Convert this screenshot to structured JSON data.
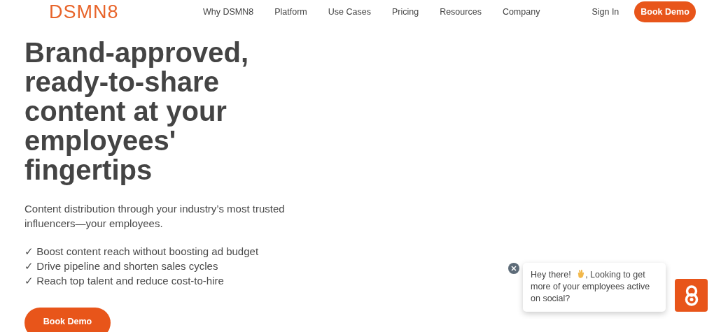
{
  "logo": "DSMN8",
  "nav": [
    "Why DSMN8",
    "Platform",
    "Use Cases",
    "Pricing",
    "Resources",
    "Company"
  ],
  "sign_in": "Sign In",
  "header_button": "Book Demo",
  "headline": "Brand-approved, ready-to-share content at your employees' fingertips",
  "subtitle": "Content distribution through your industry’s most trusted influencers—your employees.",
  "benefits": [
    "✓ Boost content reach without boosting ad budget",
    "✓ Drive pipeline and shorten sales cycles",
    "✓ Reach top talent and reduce cost-to-hire"
  ],
  "cta_button": "Book Demo",
  "chat": {
    "greeting": "Hey there!",
    "message": ", Looking to get more of your employees active on social?"
  }
}
